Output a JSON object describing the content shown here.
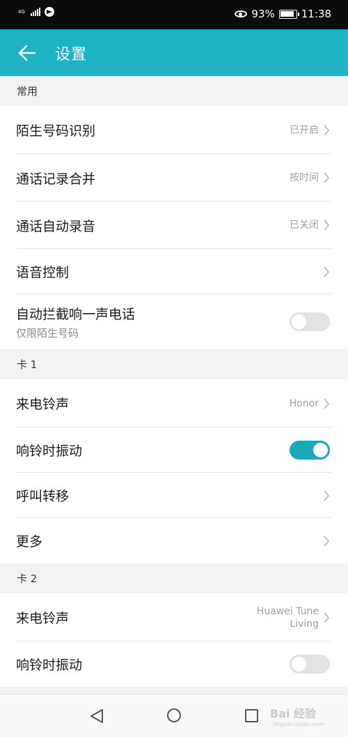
{
  "status_bar": {
    "network": "4G",
    "battery": "93%",
    "time": "11:38"
  },
  "app_bar": {
    "title": "设置",
    "back_icon": "back-arrow-icon"
  },
  "sections": [
    {
      "header": "常用",
      "rows": [
        {
          "title": "陌生号码识别",
          "value": "已开启",
          "type": "link"
        },
        {
          "title": "通话记录合并",
          "value": "按时间",
          "type": "link"
        },
        {
          "title": "通话自动录音",
          "value": "已关闭",
          "type": "link"
        },
        {
          "title": "语音控制",
          "value": "",
          "type": "link"
        },
        {
          "title": "自动拦截响一声电话",
          "subtitle": "仅限陌生号码",
          "type": "toggle",
          "on": false
        }
      ]
    },
    {
      "header": "卡 1",
      "rows": [
        {
          "title": "来电铃声",
          "value": "Honor",
          "type": "link"
        },
        {
          "title": "响铃时振动",
          "type": "toggle",
          "on": true
        },
        {
          "title": "呼叫转移",
          "value": "",
          "type": "link"
        },
        {
          "title": "更多",
          "value": "",
          "type": "link"
        }
      ]
    },
    {
      "header": "卡 2",
      "rows": [
        {
          "title": "来电铃声",
          "value_line1": "Huawei Tune",
          "value_line2": "Living",
          "type": "link"
        },
        {
          "title": "响铃时振动",
          "type": "toggle",
          "on": false
        }
      ]
    }
  ],
  "watermark": {
    "main": "Bai 经验",
    "sub": "jingyan.baidu.com"
  },
  "colors": {
    "accent": "#1eb3c3",
    "toggle_on": "#1aa9bc"
  }
}
